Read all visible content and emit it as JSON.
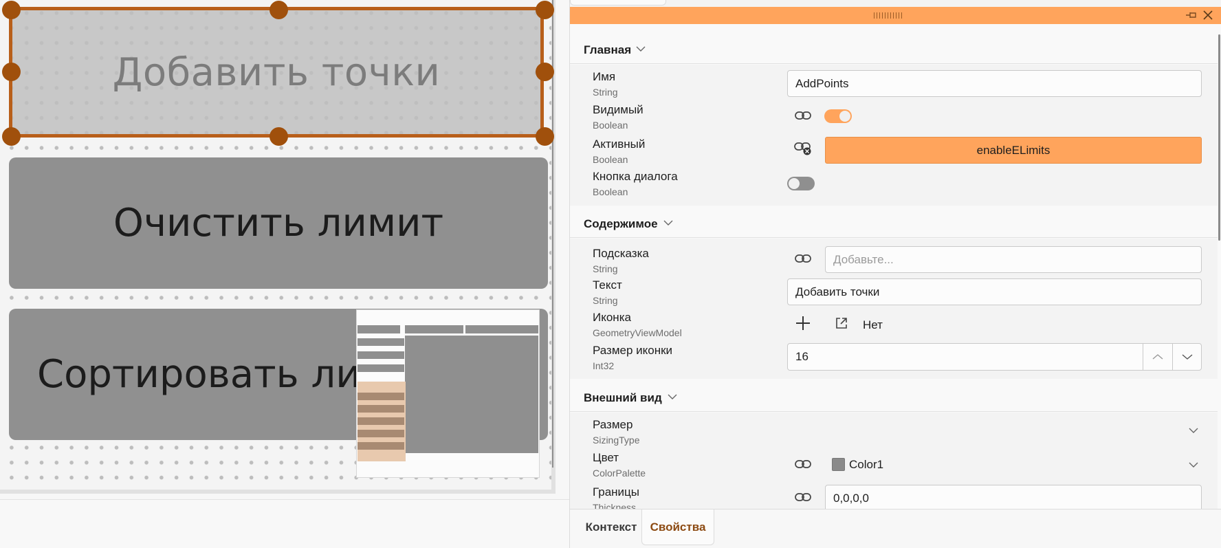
{
  "canvas": {
    "selected_button_label": "Добавить точки",
    "button2_label": "Очистить лимит",
    "button3_label": "Сортировать лимит"
  },
  "panel": {
    "sections": {
      "main": {
        "title": "Главная",
        "props": {
          "name": {
            "label": "Имя",
            "type": "String",
            "value": "AddPoints"
          },
          "visible": {
            "label": "Видимый",
            "type": "Boolean",
            "value": true
          },
          "active": {
            "label": "Активный",
            "type": "Boolean",
            "binding": "enableELimits"
          },
          "dialog_button": {
            "label": "Кнопка диалога",
            "type": "Boolean",
            "value": false
          }
        }
      },
      "content": {
        "title": "Содержимое",
        "props": {
          "tooltip": {
            "label": "Подсказка",
            "type": "String",
            "placeholder": "Добавьте..."
          },
          "text": {
            "label": "Текст",
            "type": "String",
            "value": "Добавить точки"
          },
          "icon": {
            "label": "Иконка",
            "type": "GeometryViewModel",
            "value": "Нет"
          },
          "icon_size": {
            "label": "Размер иконки",
            "type": "Int32",
            "value": "16"
          }
        }
      },
      "appearance": {
        "title": "Внешний вид",
        "props": {
          "size": {
            "label": "Размер",
            "type": "SizingType"
          },
          "color": {
            "label": "Цвет",
            "type": "ColorPalette",
            "value": "Color1",
            "swatch": "#8a8a8a"
          },
          "borders": {
            "label": "Границы",
            "type": "Thickness",
            "value": "0,0,0,0"
          }
        }
      }
    },
    "tabs": {
      "context": "Контекст",
      "properties": "Свойства"
    }
  },
  "colors": {
    "accent": "#ffa45c",
    "selection": "#b85f1a",
    "handle": "#a0500c",
    "active_tab_text": "#8c4a12"
  }
}
